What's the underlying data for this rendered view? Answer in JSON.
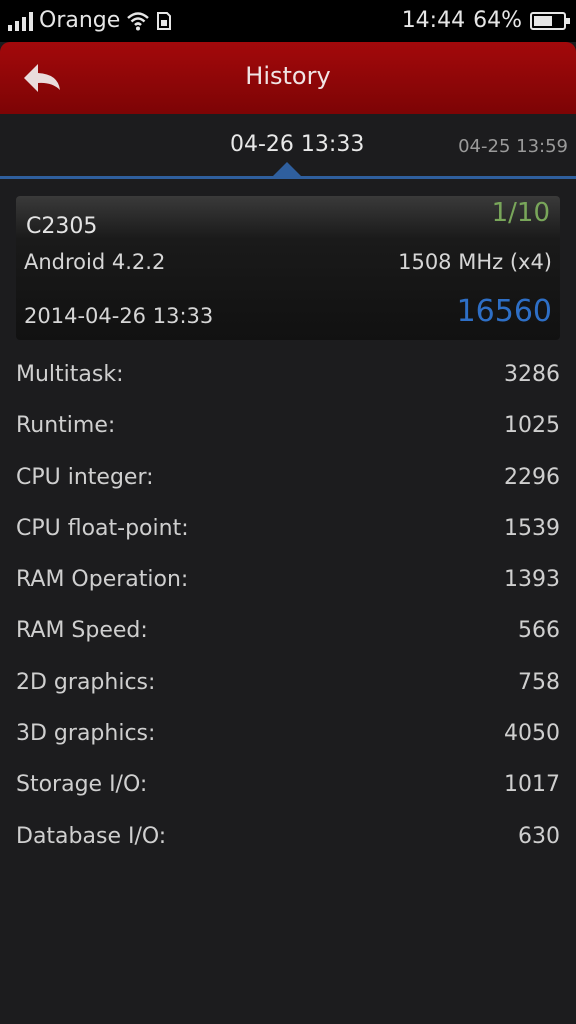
{
  "status_bar": {
    "carrier": "Orange",
    "time": "14:44",
    "battery": "64%",
    "battery_level": 0.64
  },
  "header": {
    "title": "History",
    "back_icon": "back-arrow-icon"
  },
  "tabs": {
    "active": "04-26 13:33",
    "next": "04-25 13:59"
  },
  "summary": {
    "device": "C2305",
    "page": "1/10",
    "os": "Android 4.2.2",
    "cpu": "1508 MHz (x4)",
    "date": "2014-04-26 13:33",
    "score": "16560"
  },
  "results": [
    {
      "label": "Multitask:",
      "value": "3286"
    },
    {
      "label": "Runtime:",
      "value": "1025"
    },
    {
      "label": "CPU integer:",
      "value": "2296"
    },
    {
      "label": "CPU float-point:",
      "value": "1539"
    },
    {
      "label": "RAM Operation:",
      "value": "1393"
    },
    {
      "label": "RAM Speed:",
      "value": "566"
    },
    {
      "label": "2D graphics:",
      "value": "758"
    },
    {
      "label": "3D graphics:",
      "value": "4050"
    },
    {
      "label": "Storage I/O:",
      "value": "1017"
    },
    {
      "label": "Database I/O:",
      "value": "630"
    }
  ],
  "colors": {
    "header_red": "#a3090b",
    "accent_blue": "#2f5f9e",
    "score_blue": "#2e6fc6",
    "page_green": "#79a65a"
  }
}
